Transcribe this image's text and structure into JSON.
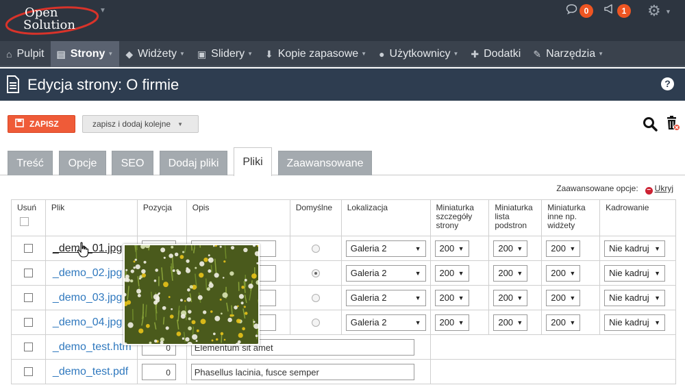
{
  "brand": {
    "line1": "Open",
    "line2": "Solution"
  },
  "notifications": {
    "messages_count": "0",
    "alerts_count": "1"
  },
  "nav": [
    {
      "label": "Pulpit",
      "icon": "home-icon",
      "caret": false,
      "active": false
    },
    {
      "label": "Strony",
      "icon": "document-icon",
      "caret": true,
      "active": true
    },
    {
      "label": "Widżety",
      "icon": "cube-icon",
      "caret": true,
      "active": false
    },
    {
      "label": "Slidery",
      "icon": "image-icon",
      "caret": true,
      "active": false
    },
    {
      "label": "Kopie zapasowe",
      "icon": "download-icon",
      "caret": true,
      "active": false
    },
    {
      "label": "Użytkownicy",
      "icon": "user-icon",
      "caret": true,
      "active": false
    },
    {
      "label": "Dodatki",
      "icon": "puzzle-icon",
      "caret": false,
      "active": false
    },
    {
      "label": "Narzędzia",
      "icon": "wrench-icon",
      "caret": true,
      "active": false
    }
  ],
  "page": {
    "title": "Edycja strony: O firmie",
    "help": "?"
  },
  "toolbar": {
    "save_label": "ZAPISZ",
    "save_add_label": "zapisz i dodaj kolejne"
  },
  "tabs": [
    {
      "label": "Treść",
      "active": false
    },
    {
      "label": "Opcje",
      "active": false
    },
    {
      "label": "SEO",
      "active": false
    },
    {
      "label": "Dodaj pliki",
      "active": false
    },
    {
      "label": "Pliki",
      "active": true
    },
    {
      "label": "Zaawansowane",
      "active": false
    }
  ],
  "advanced": {
    "label": "Zaawansowane opcje:",
    "hide_label": "Ukryj"
  },
  "table": {
    "headers": {
      "delete": "Usuń",
      "file": "Plik",
      "position": "Pozycja",
      "description": "Opis",
      "default": "Domyślne",
      "location": "Lokalizacja",
      "thumb_detail": "Miniaturka szczegóły strony",
      "thumb_list": "Miniaturka lista podstron",
      "thumb_other": "Miniaturka inne np. widżety",
      "crop": "Kadrowanie"
    },
    "rows": [
      {
        "file": "_demo_01.jpg",
        "position": "",
        "description": "",
        "default": false,
        "location": "Galeria 2",
        "thumb_detail": "200",
        "thumb_list": "200",
        "thumb_other": "200",
        "crop": "Nie kadruj",
        "image": true
      },
      {
        "file": "_demo_02.jpg",
        "position": "",
        "description": "",
        "default": true,
        "location": "Galeria 2",
        "thumb_detail": "200",
        "thumb_list": "200",
        "thumb_other": "200",
        "crop": "Nie kadruj",
        "image": true
      },
      {
        "file": "_demo_03.jpg",
        "position": "",
        "description": "",
        "default": false,
        "location": "Galeria 2",
        "thumb_detail": "200",
        "thumb_list": "200",
        "thumb_other": "200",
        "crop": "Nie kadruj",
        "image": true
      },
      {
        "file": "_demo_04.jpg",
        "position": "",
        "description": "",
        "default": false,
        "location": "Galeria 2",
        "thumb_detail": "200",
        "thumb_list": "200",
        "thumb_other": "200",
        "crop": "Nie kadruj",
        "image": true
      },
      {
        "file": "_demo_test.htm",
        "position": "0",
        "description": "Elementum sit amet",
        "image": false
      },
      {
        "file": "_demo_test.pdf",
        "position": "0",
        "description": "Phasellus lacinia, fusce semper",
        "image": false
      }
    ]
  },
  "colors": {
    "topbar": "#2d3540",
    "nav": "#3a424d",
    "titlebar": "#2e3d50",
    "save": "#ef5b38",
    "link": "#2f78be",
    "badge": "#ee5522"
  }
}
